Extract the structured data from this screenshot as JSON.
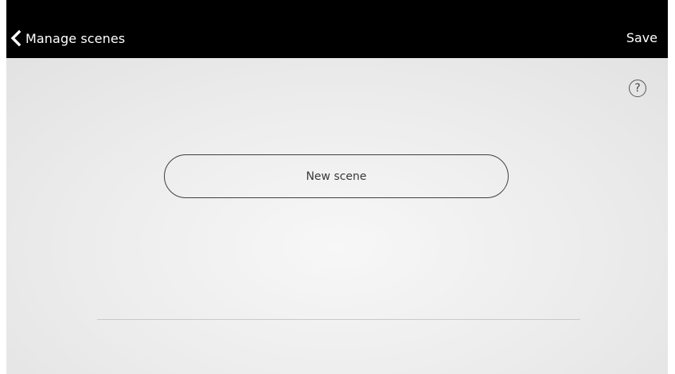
{
  "header": {
    "back_icon": "chevron-left-icon",
    "title": "Manage scenes",
    "save_label": "Save"
  },
  "main": {
    "help_icon": "question-mark-icon",
    "help_symbol": "?",
    "new_scene_label": "New scene"
  },
  "colors": {
    "header_bg": "#000000",
    "header_text": "#ffffff",
    "content_bg": "#ececec",
    "button_border": "#3f3f3f",
    "divider": "#c9c9c9"
  }
}
